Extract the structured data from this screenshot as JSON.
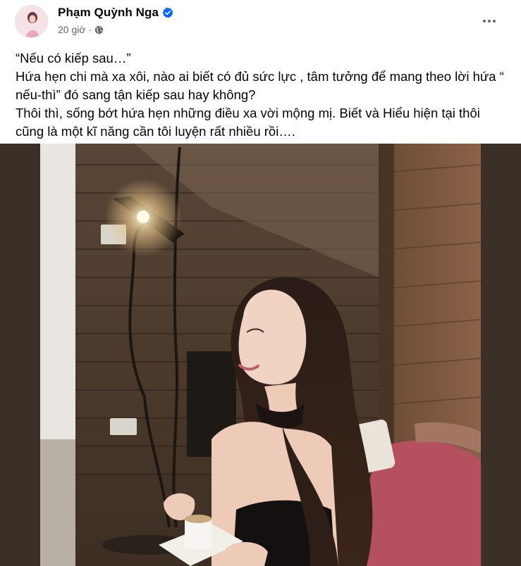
{
  "post": {
    "author_name": "Phạm Quỳnh Nga",
    "timestamp": "20 giờ",
    "separator": "·",
    "privacy_icon": "globe-icon",
    "verified_icon": "verified-badge-icon",
    "more_icon": "more-options-icon",
    "text_lines": [
      "“Nếu có kiếp sau…”",
      "Hứa hẹn chi mà xa xôi, nào ai biết có đủ sức lực , tâm tưởng để mang theo lời hứa “",
      "nếu-thì” đó sang tận kiếp sau hay không?",
      "Thôi thì, sống bớt hứa hẹn những điều xa vời mộng mị. Biết và Hiểu hiện tại thôi",
      "cũng là một kĩ năng cần tôi luyện rất nhiều rồi…."
    ]
  },
  "colors": {
    "verified_blue": "#0866ff",
    "secondary_text": "#65676b"
  }
}
